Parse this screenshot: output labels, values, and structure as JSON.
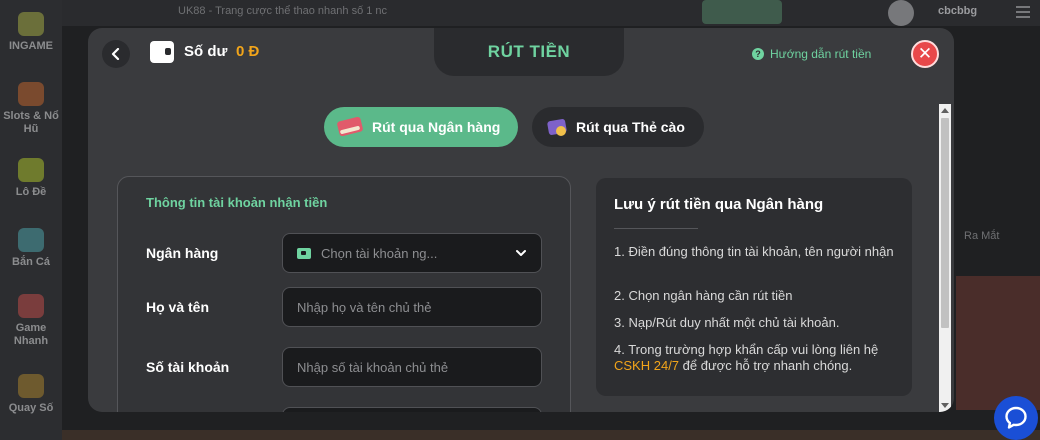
{
  "background": {
    "topbar_text": "UK88 - Trang cược thể thao nhanh số 1 nc",
    "username": "cbcbbg",
    "right_label": "Ra Mắt",
    "sidebar": [
      {
        "label": "INGAME",
        "icon": "ingame-icon",
        "color": "#6b6f3a"
      },
      {
        "label": "Slots & Nổ Hũ",
        "icon": "slots-icon",
        "color": "#7a4a2e"
      },
      {
        "label": "Lô Đề",
        "icon": "lode-icon",
        "color": "#6f7b2d"
      },
      {
        "label": "Bắn Cá",
        "icon": "fish-icon",
        "color": "#3d6b70"
      },
      {
        "label": "Game Nhanh",
        "icon": "game-icon",
        "color": "#7a3d3d"
      },
      {
        "label": "Quay Số",
        "icon": "lottery-icon",
        "color": "#6e5a2e"
      }
    ]
  },
  "modal": {
    "title": "RÚT TIỀN",
    "balance_label": "Số dư",
    "balance_value": "0 Đ",
    "guide_label": "Hướng dẫn rút tiền",
    "methods": {
      "bank": "Rút qua Ngân hàng",
      "card": "Rút qua Thẻ cào"
    },
    "form": {
      "heading": "Thông tin tài khoản nhận tiền",
      "bank_label": "Ngân hàng",
      "bank_placeholder": "Chọn tài khoản ng...",
      "name_label": "Họ và tên",
      "name_placeholder": "Nhập họ và tên chủ thẻ",
      "account_label": "Số tài khoản",
      "account_placeholder": "Nhập số tài khoản chủ thẻ"
    },
    "notes": {
      "title": "Lưu ý rút tiền qua Ngân hàng",
      "items": [
        "1. Điền đúng thông tin tài khoản, tên người nhận",
        "2. Chọn ngân hàng cần rút tiền",
        "3. Nạp/Rút duy nhất một chủ tài khoản."
      ],
      "item4_before": "4. Trong trường hợp khẩn cấp vui lòng liên hệ",
      "item4_link": "CSKH 24/7",
      "item4_after": "để được hỗ trợ nhanh chóng."
    }
  },
  "colors": {
    "accent": "#6fd3a0",
    "accent_button": "#5bb98a",
    "balance": "#f2a51a",
    "close": "#e8484a",
    "chat": "#1a4fd6"
  }
}
